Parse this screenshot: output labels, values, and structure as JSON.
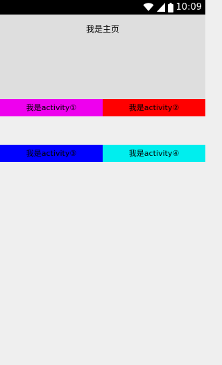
{
  "status_bar": {
    "time": "10:09",
    "icons": [
      "wifi-icon",
      "signal-icon",
      "battery-icon"
    ]
  },
  "main": {
    "title": "我是主页"
  },
  "buttons": [
    {
      "label": "我是activity①",
      "color": "#ee00ee"
    },
    {
      "label": "我是activity②",
      "color": "#ff0000"
    },
    {
      "label": "我是activity③",
      "color": "#0000ff"
    },
    {
      "label": "我是activity④",
      "color": "#00eeee"
    }
  ]
}
